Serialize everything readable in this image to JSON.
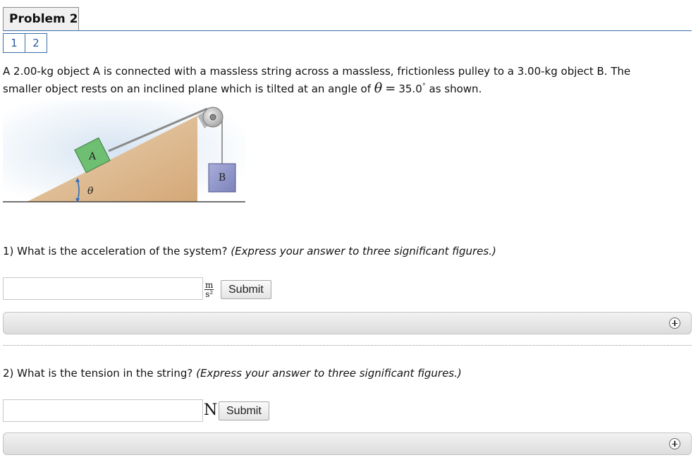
{
  "header": {
    "title": "Problem 2",
    "pages": [
      "1",
      "2"
    ]
  },
  "intro": {
    "line1": "A 2.00-kg object A is connected with a massless string across a massless, frictionless pulley to a 3.00-kg object B. The",
    "line2_prefix": "smaller object rests on an inclined plane which is tilted at an angle of ",
    "theta": "θ",
    "equals": "=",
    "angle_value": "35.0",
    "degree": "°",
    "line2_suffix": " as shown."
  },
  "diagram": {
    "block_a_label": "A",
    "block_b_label": "B",
    "angle_label": "θ"
  },
  "questions": [
    {
      "prompt": "1) What is the acceleration of the system? ",
      "hint": "(Express your answer to three significant figures.)",
      "unit_num": "m",
      "unit_den": "s²",
      "input_value": "",
      "submit_label": "Submit"
    },
    {
      "prompt": "2) What is the tension in the string? ",
      "hint": "(Express your answer to three significant figures.)",
      "unit": "N",
      "input_value": "",
      "submit_label": "Submit"
    }
  ],
  "icons": {
    "expand": "plus-circle-icon"
  },
  "colors": {
    "link": "#2a5d9f",
    "border_accent": "#3b6ea5",
    "block_a": "#6fbf73",
    "block_b": "#8f96c8",
    "incline": "#d9b48a"
  }
}
